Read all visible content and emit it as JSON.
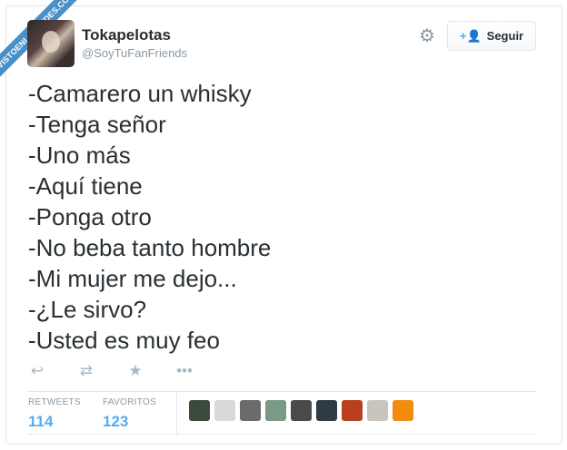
{
  "watermark": "VISTOENLASREDES.COM",
  "user": {
    "name": "Tokapelotas",
    "handle": "@SoyTuFanFriends"
  },
  "icons": {
    "settings": "gear-icon",
    "follow": "add-user-icon",
    "reply": "reply-icon",
    "retweet": "retweet-icon",
    "favorite": "star-icon",
    "more": "more-icon"
  },
  "follow_label": "Seguir",
  "tweet_lines": [
    "-Camarero un whisky",
    "-Tenga señor",
    "-Uno más",
    "-Aquí tiene",
    "-Ponga otro",
    "-No beba tanto hombre",
    "-Mi mujer me dejo...",
    "-¿Le sirvo?",
    "-Usted es muy feo"
  ],
  "stats": {
    "retweets_label": "RETWEETS",
    "retweets": "114",
    "favorites_label": "FAVORITOS",
    "favorites": "123"
  },
  "favoriter_colors": [
    "#3b4a3a",
    "#d9d9d9",
    "#6b6b6b",
    "#7a9a86",
    "#4a4a4a",
    "#2f3a44",
    "#b8401f",
    "#c9c4be",
    "#f28c0f"
  ],
  "colors": {
    "accent": "#55acee",
    "text": "#292f33",
    "muted": "#8899a6"
  }
}
